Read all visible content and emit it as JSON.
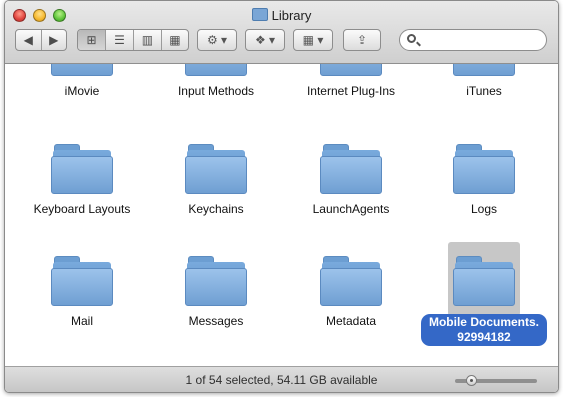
{
  "window": {
    "title": "Library"
  },
  "toolbar": {
    "back_label": "◀",
    "forward_label": "▶",
    "view_icons": [
      "⊞",
      "☰",
      "▥",
      "▦"
    ],
    "action_label": "⚙ ▾",
    "dropbox_label": "❖ ▾",
    "arrange_label": "▦ ▾",
    "share_label": "⇪",
    "search_placeholder": ""
  },
  "content": {
    "items": [
      {
        "label": "iMovie"
      },
      {
        "label": "Input Methods"
      },
      {
        "label": "Internet Plug-Ins"
      },
      {
        "label": "iTunes"
      },
      {
        "label": "Keyboard Layouts"
      },
      {
        "label": "Keychains"
      },
      {
        "label": "LaunchAgents"
      },
      {
        "label": "Logs"
      },
      {
        "label": "Mail"
      },
      {
        "label": "Messages"
      },
      {
        "label": "Metadata"
      },
      {
        "label_line1": "Mobile Documents.",
        "label_line2": "92994182",
        "selected": true
      }
    ]
  },
  "status": {
    "text": "1 of 54 selected, 54.11 GB available",
    "icon_size_level": 0.15
  }
}
